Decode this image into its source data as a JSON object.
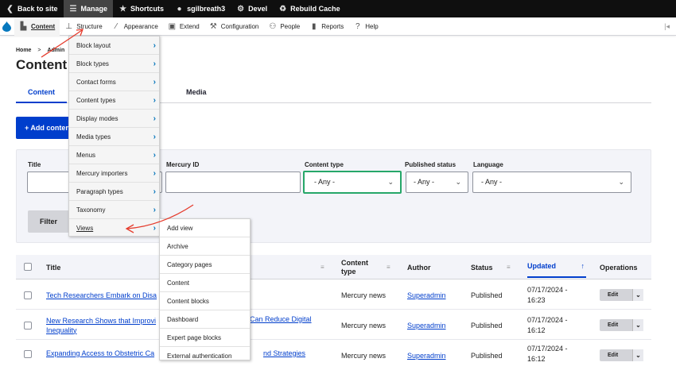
{
  "toolbar": {
    "back": "Back to site",
    "manage": "Manage",
    "shortcuts": "Shortcuts",
    "user": "sgilbreath3",
    "devel": "Devel",
    "rebuild": "Rebuild Cache"
  },
  "tray": {
    "items": [
      "Content",
      "Structure",
      "Appearance",
      "Extend",
      "Configuration",
      "People",
      "Reports",
      "Help"
    ]
  },
  "breadcrumb": [
    "Home",
    ">",
    "Admin"
  ],
  "page_title": "Content",
  "tabs": [
    "Content",
    "Media"
  ],
  "add_button": "+ Add content",
  "filters": {
    "title_label": "Title",
    "mercury_label": "Mercury ID",
    "content_type_label": "Content type",
    "content_type_value": "- Any -",
    "published_label": "Published status",
    "published_value": "- Any -",
    "language_label": "Language",
    "language_value": "- Any -",
    "filter_button": "Filter"
  },
  "structure_menu": [
    "Block layout",
    "Block types",
    "Contact forms",
    "Content types",
    "Display modes",
    "Media types",
    "Menus",
    "Mercury importers",
    "Paragraph types",
    "Taxonomy",
    "Views"
  ],
  "views_menu": [
    "Add view",
    "Archive",
    "Category pages",
    "Content",
    "Content blocks",
    "Dashboard",
    "Expert page blocks",
    "External authentication"
  ],
  "table": {
    "headers": {
      "title": "Title",
      "content_type_1": "Content",
      "content_type_2": "type",
      "author": "Author",
      "status": "Status",
      "updated": "Updated",
      "operations": "Operations"
    },
    "sort_arrow": "↑",
    "rows": [
      {
        "title": "Tech Researchers Embark on Disa",
        "title2": "",
        "type": "Mercury news",
        "author": "Superadmin",
        "status": "Published",
        "date": "07/17/2024 -",
        "time": "16:23",
        "op": "Edit"
      },
      {
        "title": "New Research Shows that Improvi",
        "title_tail": "Can Reduce Digital",
        "title2": "Inequality",
        "type": "Mercury news",
        "author": "Superadmin",
        "status": "Published",
        "date": "07/17/2024 -",
        "time": "16:12",
        "op": "Edit"
      },
      {
        "title": "Expanding Access to Obstetric Ca",
        "title_tail": "nd Strategies",
        "title2": "",
        "type": "Mercury news",
        "author": "Superadmin",
        "status": "Published",
        "date": "07/17/2024 -",
        "time": "16:12",
        "op": "Edit"
      }
    ]
  },
  "colors": {
    "accent": "#003ecc",
    "toolbar_bg": "#0f0f0f",
    "annotation": "#e53b2c",
    "focus": "#26a769"
  }
}
